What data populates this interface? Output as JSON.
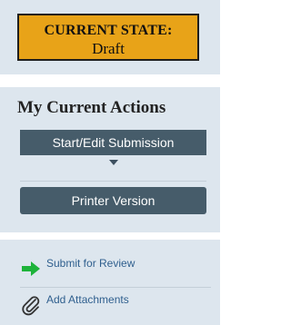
{
  "state": {
    "heading": "CURRENT STATE:",
    "value": "Draft"
  },
  "actions": {
    "heading": "My Current Actions",
    "start_edit_label": "Start/Edit Submission",
    "printer_label": "Printer Version",
    "dropdown_icon": "caret-down-icon"
  },
  "links": [
    {
      "label": "Submit for Review",
      "icon": "green-arrow-right-icon"
    },
    {
      "label": "Add Attachments",
      "icon": "paperclip-icon"
    }
  ],
  "colors": {
    "state_box": "#e8a318",
    "panel": "#dde6ee",
    "button": "#465c6a",
    "link": "#2f5f8e",
    "arrow": "#1db33a"
  }
}
